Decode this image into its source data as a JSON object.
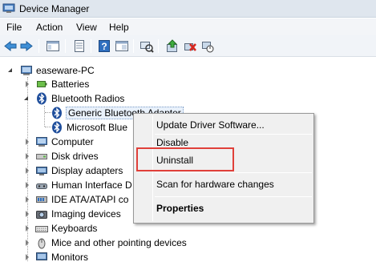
{
  "window": {
    "title": "Device Manager"
  },
  "menu": [
    "File",
    "Action",
    "View",
    "Help"
  ],
  "toolbar_icons": [
    "back-arrow-icon",
    "forward-arrow-icon",
    "show-hide-console-tree-icon",
    "properties-icon",
    "help-icon",
    "scan-hardware-icon",
    "update-driver-icon",
    "uninstall-icon",
    "disable-icon"
  ],
  "tree": {
    "root": "easeware-PC",
    "items": [
      {
        "label": "Batteries",
        "icon": "battery-icon"
      },
      {
        "label": "Bluetooth Radios",
        "icon": "bluetooth-icon",
        "expanded": true,
        "children": [
          {
            "label": "Generic Bluetooth Adapter",
            "icon": "bluetooth-icon",
            "selected": true
          },
          {
            "label": "Microsoft Blue",
            "icon": "bluetooth-icon"
          }
        ]
      },
      {
        "label": "Computer",
        "icon": "computer-icon"
      },
      {
        "label": "Disk drives",
        "icon": "disk-drive-icon"
      },
      {
        "label": "Display adapters",
        "icon": "display-adapter-icon"
      },
      {
        "label": "Human Interface D",
        "icon": "hid-icon"
      },
      {
        "label": "IDE ATA/ATAPI co",
        "icon": "ide-controller-icon"
      },
      {
        "label": "Imaging devices",
        "icon": "camera-icon"
      },
      {
        "label": "Keyboards",
        "icon": "keyboard-icon"
      },
      {
        "label": "Mice and other pointing devices",
        "icon": "mouse-icon"
      },
      {
        "label": "Monitors",
        "icon": "monitor-icon"
      }
    ]
  },
  "context_menu": {
    "items": [
      "Update Driver Software...",
      "Disable",
      "Uninstall",
      "Scan for hardware changes",
      "Properties"
    ],
    "highlighted": "Uninstall"
  },
  "colors": {
    "highlight_box": "#e0403a"
  }
}
